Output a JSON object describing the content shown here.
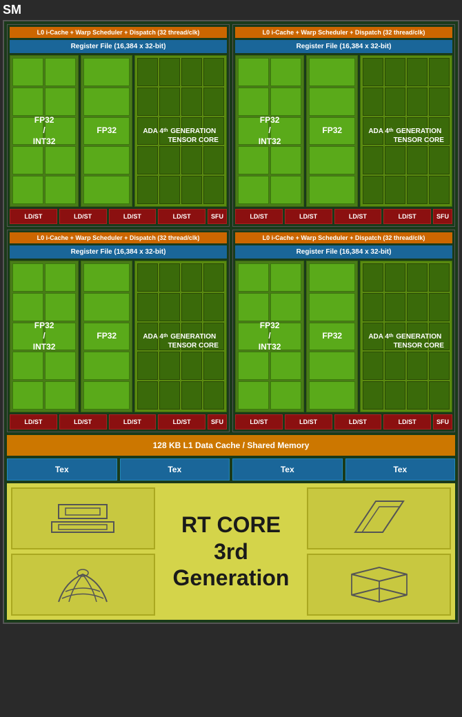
{
  "sm_label": "SM",
  "quadrants": [
    {
      "id": "q1",
      "warp_label": "L0 i-Cache + Warp Scheduler + Dispatch (32 thread/clk)",
      "register_label": "Register File (16,384 x 32-bit)",
      "fp32_int32_label": "FP32\n/\nINT32",
      "fp32_label": "FP32",
      "tensor_label": "ADA 4th GENERATION TENSOR CORE",
      "ldst_labels": [
        "LD/ST",
        "LD/ST",
        "LD/ST",
        "LD/ST"
      ],
      "sfu_label": "SFU"
    },
    {
      "id": "q2",
      "warp_label": "L0 i-Cache + Warp Scheduler + Dispatch (32 thread/clk)",
      "register_label": "Register File (16,384 x 32-bit)",
      "fp32_int32_label": "FP32\n/\nINT32",
      "fp32_label": "FP32",
      "tensor_label": "ADA 4th GENERATION TENSOR CORE",
      "ldst_labels": [
        "LD/ST",
        "LD/ST",
        "LD/ST",
        "LD/ST"
      ],
      "sfu_label": "SFU"
    },
    {
      "id": "q3",
      "warp_label": "L0 i-Cache + Warp Scheduler + Dispatch (32 thread/clk)",
      "register_label": "Register File (16,384 x 32-bit)",
      "fp32_int32_label": "FP32\n/\nINT32",
      "fp32_label": "FP32",
      "tensor_label": "ADA 4th GENERATION TENSOR CORE",
      "ldst_labels": [
        "LD/ST",
        "LD/ST",
        "LD/ST",
        "LD/ST"
      ],
      "sfu_label": "SFU"
    },
    {
      "id": "q4",
      "warp_label": "L0 i-Cache + Warp Scheduler + Dispatch (32 thread/clk)",
      "register_label": "Register File (16,384 x 32-bit)",
      "fp32_int32_label": "FP32\n/\nINT32",
      "fp32_label": "FP32",
      "tensor_label": "ADA 4th GENERATION TENSOR CORE",
      "ldst_labels": [
        "LD/ST",
        "LD/ST",
        "LD/ST",
        "LD/ST"
      ],
      "sfu_label": "SFU"
    }
  ],
  "l1_cache_label": "128 KB L1 Data Cache / Shared Memory",
  "tex_labels": [
    "Tex",
    "Tex",
    "Tex",
    "Tex"
  ],
  "rt_core_line1": "RT CORE",
  "rt_core_line2": "3rd Generation"
}
